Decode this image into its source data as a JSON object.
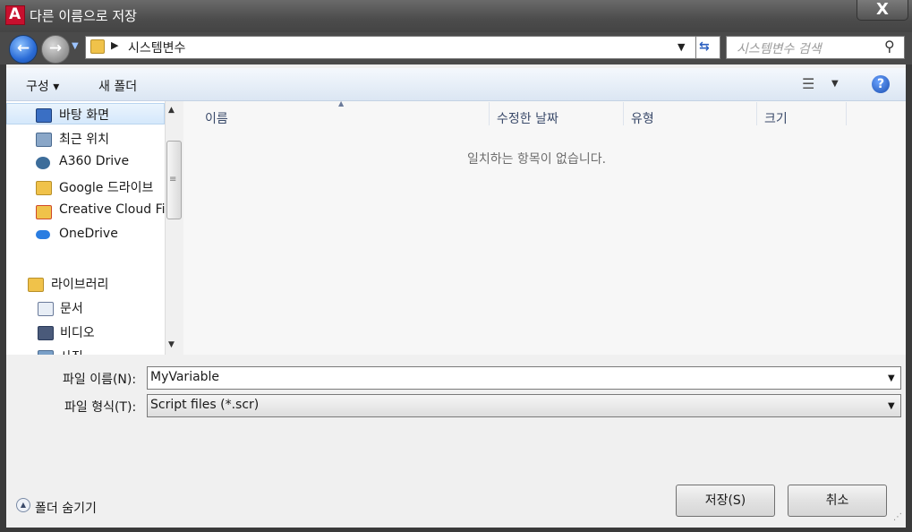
{
  "window": {
    "title": "다른 이름으로 저장",
    "close_glyph": "X"
  },
  "address": {
    "crumb": "시스템변수",
    "search_placeholder": "시스템변수 검색"
  },
  "toolbar": {
    "organize": "구성 ▾",
    "new_folder": "새 폴더",
    "help": "?"
  },
  "nav": {
    "items": [
      {
        "label": "바탕 화면",
        "icon": "desktop-icon"
      },
      {
        "label": "최근 위치",
        "icon": "recent-places-icon"
      },
      {
        "label": "A360 Drive",
        "icon": "a360-drive-icon"
      },
      {
        "label": "Google 드라이브",
        "icon": "google-drive-icon"
      },
      {
        "label": "Creative Cloud Fi",
        "icon": "creative-cloud-icon"
      },
      {
        "label": "OneDrive",
        "icon": "onedrive-icon"
      },
      {
        "label": "라이브러리",
        "icon": "library-icon"
      },
      {
        "label": "문서",
        "icon": "documents-icon"
      },
      {
        "label": "비디오",
        "icon": "video-icon"
      },
      {
        "label": "사진",
        "icon": "pictures-icon"
      }
    ]
  },
  "filelist": {
    "columns": [
      "이름",
      "수정한 날짜",
      "유형",
      "크기"
    ],
    "empty_message": "일치하는 항목이 없습니다."
  },
  "fields": {
    "name_label": "파일 이름(N):",
    "name_value": "MyVariable",
    "type_label": "파일 형식(T):",
    "type_value": "Script files (*.scr)"
  },
  "footer": {
    "hide_folders": "폴더 숨기기",
    "save": "저장(S)",
    "cancel": "취소"
  },
  "colors": {
    "accent": "#2a6bd6",
    "app_red": "#c8102e"
  }
}
